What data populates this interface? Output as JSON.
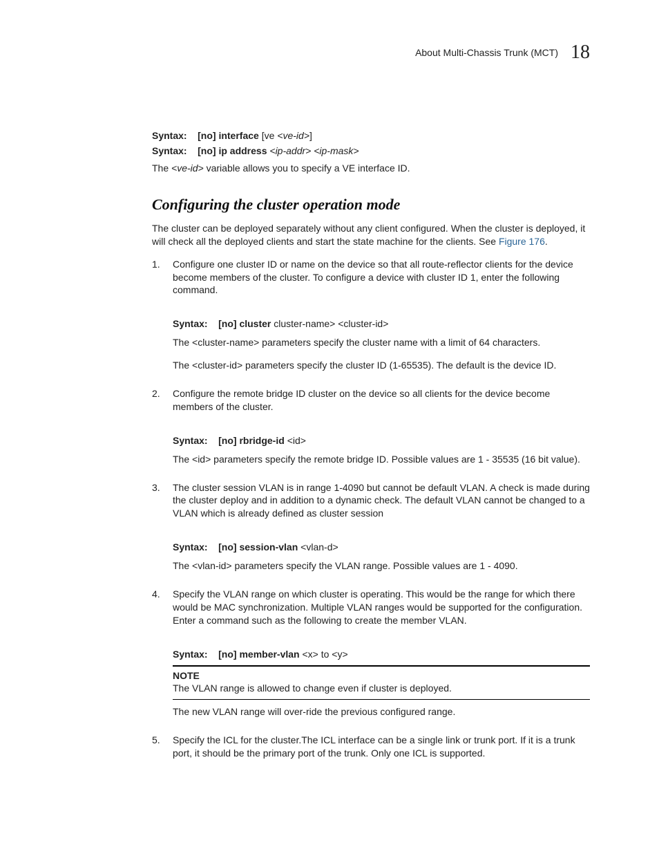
{
  "header": {
    "title": "About Multi-Chassis Trunk (MCT)",
    "chapter": "18"
  },
  "intro": {
    "syntax1_label": "Syntax:",
    "syntax1_bold": "[no] interface",
    "syntax1_plain": " [ve ",
    "syntax1_italic": "<ve-id>",
    "syntax1_end": "]",
    "syntax2_label": "Syntax:",
    "syntax2_bold": "[no] ip address",
    "syntax2_italic": " <ip-addr> <ip-mask>",
    "desc_pre": "The ",
    "desc_italic": "<ve-id>",
    "desc_post": " variable allows you to specify a VE interface ID."
  },
  "section": {
    "title": "Configuring the cluster operation mode",
    "para_pre": "The cluster can be deployed separately without any client configured. When the cluster is deployed, it will check all the deployed clients and start the state machine for the clients. See ",
    "para_link": "Figure 176",
    "para_post": "."
  },
  "steps": [
    {
      "text": "Configure one cluster ID or name on the device so that all route-reflector clients for the device become members of the cluster. To configure a device with cluster ID 1, enter the following command.",
      "syntax_label": "Syntax:",
      "syntax_bold": "[no] cluster",
      "syntax_rest": "    cluster-name> <cluster-id>",
      "sub1": "The <cluster-name> parameters specify the cluster name with a limit of 64 characters.",
      "sub2": "The <cluster-id> parameters specify the cluster ID (1-65535). The default is the device ID."
    },
    {
      "text": "Configure the remote bridge ID cluster on the device so all clients for the device become members of the cluster.",
      "syntax_label": "Syntax:",
      "syntax_bold": "[no] rbridge-id",
      "syntax_rest": " <id>",
      "sub1": "The <id> parameters specify the remote bridge ID. Possible values are 1 - 35535 (16 bit value)."
    },
    {
      "text": "The cluster session VLAN is in range 1-4090 but cannot be default VLAN. A check is made during the cluster deploy and in addition to a dynamic check. The default VLAN cannot be changed to a VLAN which is already defined as cluster session",
      "syntax_label": "Syntax:",
      "syntax_bold": "[no]  session-vlan",
      "syntax_rest": " <vlan-d>",
      "sub1": "The <vlan-id> parameters specify the VLAN range. Possible values are 1 - 4090."
    },
    {
      "text": "Specify the VLAN range on which cluster is operating. This would be the range for which there would be MAC synchronization. Multiple VLAN ranges would be supported for the configuration. Enter a command such as the following to create the member VLAN.",
      "syntax_label": "Syntax:",
      "syntax_bold": "[no] member-vlan",
      "syntax_rest": " <x> to <y>",
      "note_title": "NOTE",
      "note_body": "The VLAN range is allowed to change even if cluster is deployed.",
      "sub1": "The new VLAN range will over-ride the previous configured range."
    },
    {
      "text": "Specify the ICL for the cluster.The ICL interface can be a single link or trunk port. If it is a trunk port, it should be the primary port of the trunk. Only one ICL is supported."
    }
  ]
}
